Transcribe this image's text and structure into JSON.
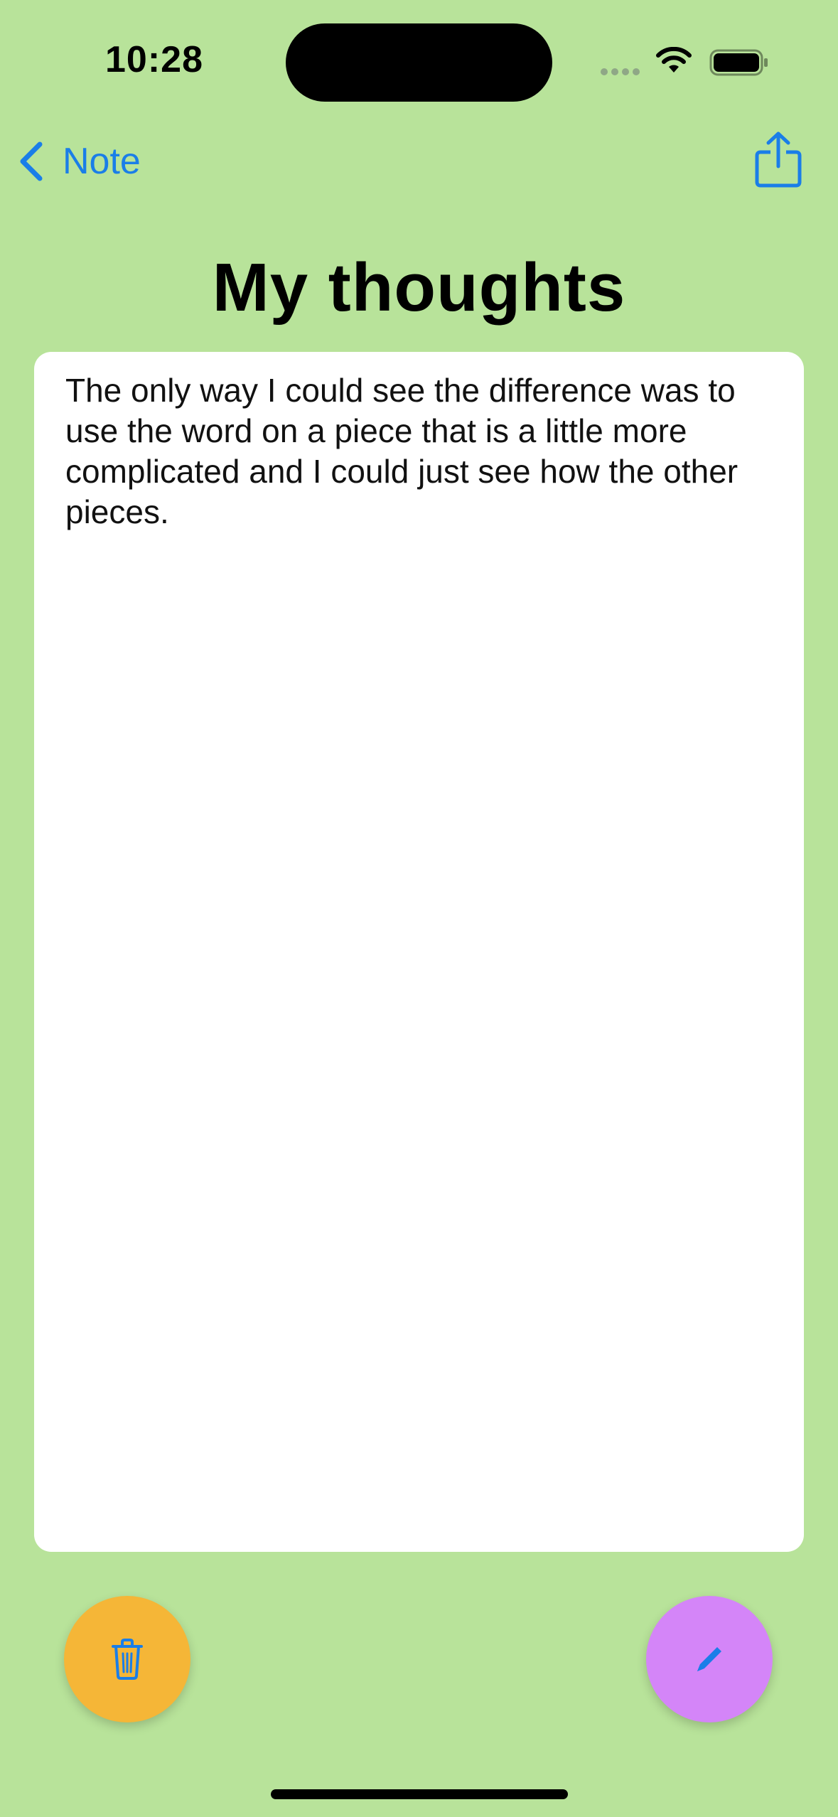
{
  "status_bar": {
    "time": "10:28"
  },
  "nav": {
    "back_label": "Note",
    "back_icon": "chevron-left-icon",
    "share_icon": "share-icon"
  },
  "title": "My thoughts",
  "note": {
    "text": "The only way I could see the difference was to use the word on a piece that is a little more complicated and I could just see how the other pieces."
  },
  "actions": {
    "delete_icon": "trash-icon",
    "edit_icon": "pencil-icon"
  },
  "colors": {
    "background": "#b8e39a",
    "accent": "#1a7ee8",
    "delete_button": "#f5b637",
    "edit_button": "#d485f8",
    "card": "#ffffff"
  }
}
